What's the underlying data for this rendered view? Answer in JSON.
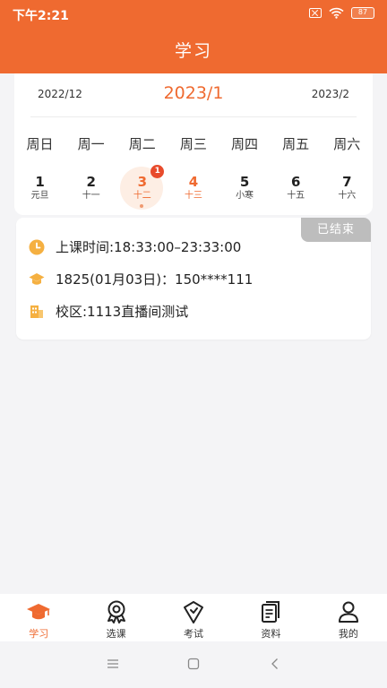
{
  "status": {
    "time": "下午2:21",
    "battery": "87"
  },
  "header": {
    "title": "学习"
  },
  "calendar": {
    "prev_month": "2022/12",
    "current_month": "2023/1",
    "next_month": "2023/2",
    "weekdays": [
      "周日",
      "周一",
      "周二",
      "周三",
      "周四",
      "周五",
      "周六"
    ],
    "days": [
      {
        "num": "1",
        "lunar": "元旦"
      },
      {
        "num": "2",
        "lunar": "十一"
      },
      {
        "num": "3",
        "lunar": "十二",
        "badge": "1"
      },
      {
        "num": "4",
        "lunar": "十三"
      },
      {
        "num": "5",
        "lunar": "小寒"
      },
      {
        "num": "6",
        "lunar": "十五"
      },
      {
        "num": "7",
        "lunar": "十六"
      }
    ]
  },
  "course": {
    "status": "已结束",
    "time": "上课时间:18:33:00–23:33:00",
    "class": "1825(01月03日)：150****111",
    "campus": "校区:1113直播间测试"
  },
  "nav": {
    "items": [
      {
        "label": "学习"
      },
      {
        "label": "选课"
      },
      {
        "label": "考试"
      },
      {
        "label": "资料"
      },
      {
        "label": "我的"
      }
    ]
  },
  "colors": {
    "accent": "#ef6a30",
    "badge": "#e84b2c",
    "ended": "#bdbdbd"
  }
}
